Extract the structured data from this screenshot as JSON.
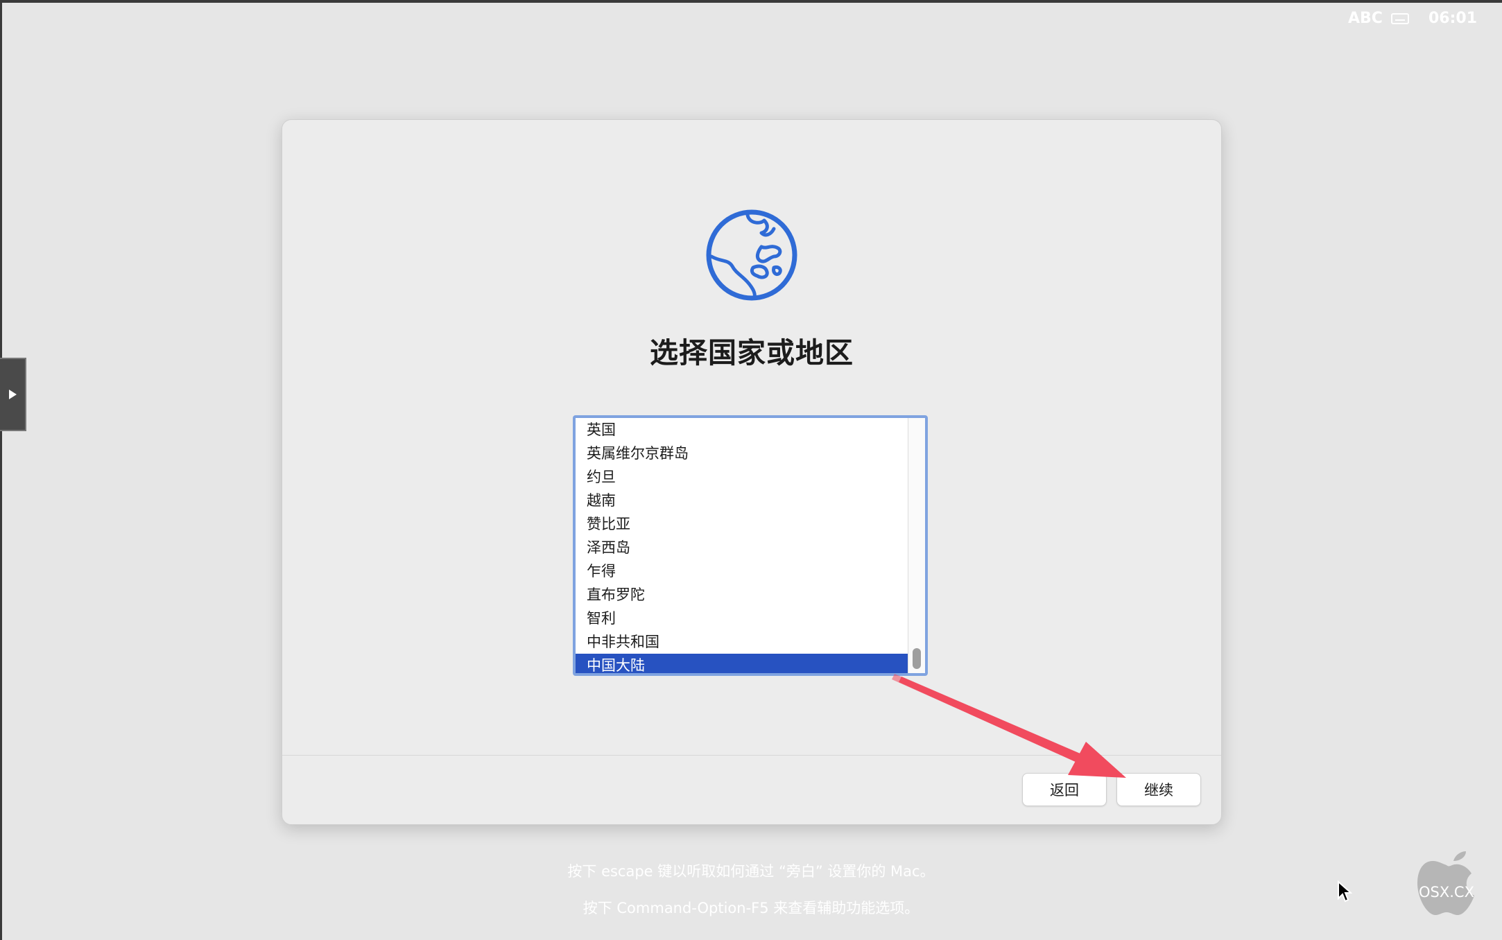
{
  "status": {
    "input_source": "ABC",
    "time": "06:01"
  },
  "dialog": {
    "title": "选择国家或地区",
    "countries": [
      "英国",
      "英属维尔京群岛",
      "约旦",
      "越南",
      "赞比亚",
      "泽西岛",
      "乍得",
      "直布罗陀",
      "智利",
      "中非共和国",
      "中国大陆"
    ],
    "selected": "中国大陆",
    "back_label": "返回",
    "continue_label": "继续"
  },
  "hints": {
    "line1": "按下 escape 键以听取如何通过 “旁白” 设置你的 Mac。",
    "line2": "按下 Command-Option-F5 来查看辅助功能选项。"
  },
  "watermark": "OSX.CX",
  "colors": {
    "accent": "#2752c1",
    "globe": "#2f6bd6",
    "arrow": "#f14b5e"
  }
}
